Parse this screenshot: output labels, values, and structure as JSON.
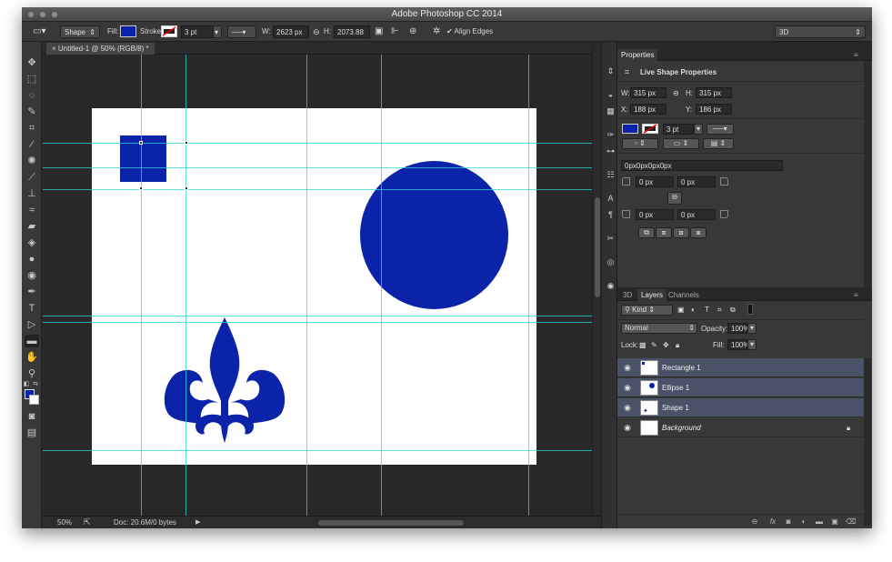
{
  "window": {
    "title": "Adobe Photoshop CC 2014"
  },
  "options_bar": {
    "mode": "Shape",
    "fill_label": "Fill:",
    "fill_color": "#0a23a8",
    "stroke_label": "Stroke:",
    "stroke_width": "3 pt",
    "w_label": "W:",
    "w_value": "2623 px",
    "h_label": "H:",
    "h_value": "2073.88",
    "align_edges": "Align Edges",
    "workspace": "3D"
  },
  "document": {
    "tab_title": "Untitled-1 @ 50% (RGB/8) *",
    "shape_color": "#0a23a8"
  },
  "status": {
    "zoom": "50%",
    "doc_info": "Doc: 20.6M/0 bytes"
  },
  "tools": [
    "move-tool",
    "marquee-tool",
    "lasso-tool",
    "quick-selection-tool",
    "crop-tool",
    "eyedropper-tool",
    "spot-healing-tool",
    "brush-tool",
    "clone-stamp-tool",
    "history-brush-tool",
    "eraser-tool",
    "paint-bucket-tool",
    "blur-tool",
    "dodge-tool",
    "pen-tool",
    "type-tool",
    "path-selection-tool",
    "rectangle-tool",
    "hand-tool",
    "zoom-tool"
  ],
  "properties": {
    "tab": "Properties",
    "header": "Live Shape Properties",
    "w_label": "W:",
    "w": "315 px",
    "h_label": "H:",
    "h": "315 px",
    "x_label": "X:",
    "x": "188 px",
    "y_label": "Y:",
    "y": "186 px",
    "stroke_width": "3 pt",
    "corner_summary": "0px0px0px0px",
    "corner_tl": "0 px",
    "corner_tr": "0 px",
    "corner_bl": "0 px",
    "corner_br": "0 px"
  },
  "layers_panel": {
    "tabs": [
      "3D",
      "Layers",
      "Channels"
    ],
    "filter": "Kind",
    "blend_mode": "Normal",
    "opacity_label": "Opacity:",
    "opacity": "100%",
    "lock_label": "Lock:",
    "fill_label": "Fill:",
    "fill": "100%",
    "layers": [
      {
        "name": "Rectangle 1",
        "selected": true
      },
      {
        "name": "Ellipse 1",
        "selected": true
      },
      {
        "name": "Shape 1",
        "selected": true
      },
      {
        "name": "Background",
        "selected": false
      }
    ]
  }
}
